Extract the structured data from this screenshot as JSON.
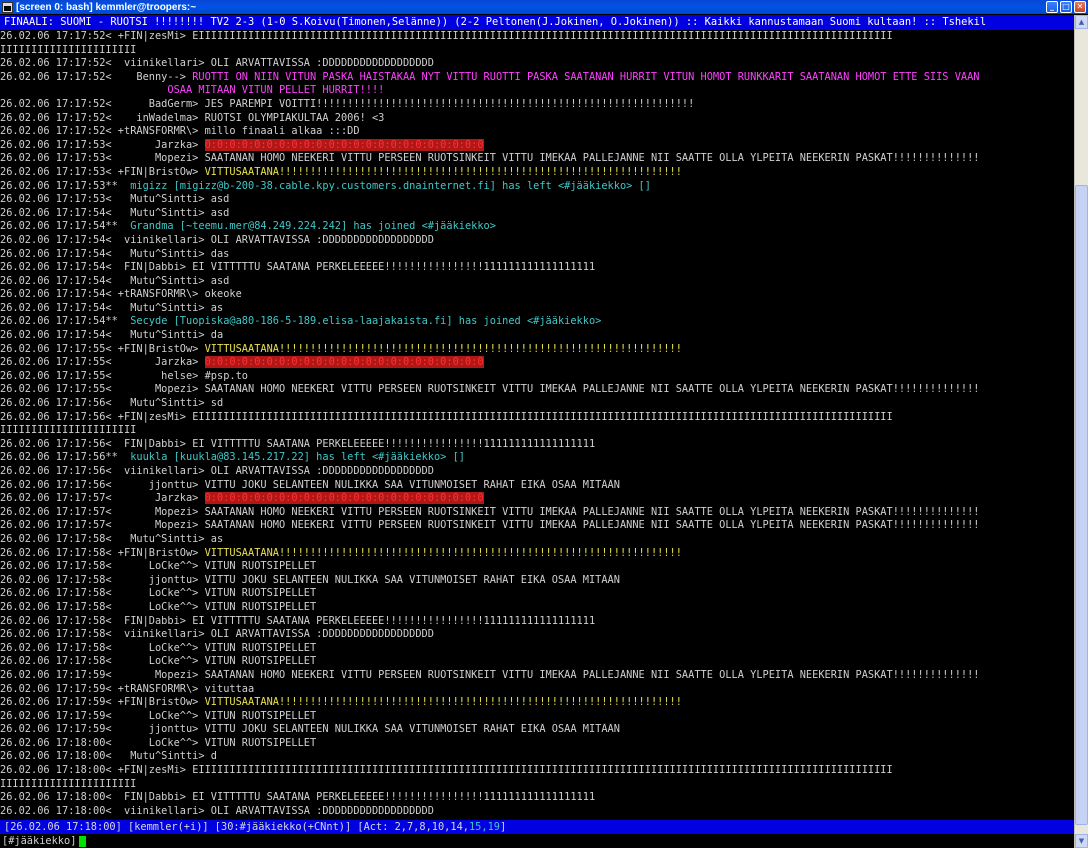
{
  "window": {
    "title": "[screen 0: bash] kemmler@troopers:~",
    "icon": "putty-terminal-icon"
  },
  "topic": "FINAALI: SUOMI - RUOTSI !!!!!!!! TV2 2-3 (1-0 S.Koivu(Timonen,Selänne)) (2-2 Peltonen(J.Jokinen, O.Jokinen)) :: Kaikki kannustamaan Suomi kultaan! :: Tshekil",
  "colors": {
    "magenta": "#ff40ff",
    "yellow": "#e8e04c",
    "cyan": "#3fc8c8",
    "red": "#b01818",
    "blue_bar": "#0000e0",
    "cursor": "#00e000"
  },
  "lines": [
    {
      "ts": "26.02.06 17:17:52",
      "nick": "< +FIN|zesMi> ",
      "msg": "EIIIIIIIIIIIIIIIIIIIIIIIIIIIIIIIIIIIIIIIIIIIIIIIIIIIIIIIIIIIIIIIIIIIIIIIIIIIIIIIIIIIIIIIIIIIIIIIIIIIIIIIIIIIIIIII",
      "style": ""
    },
    {
      "ts": "",
      "nick": "",
      "msg": "IIIIIIIIIIIIIIIIIIIIII",
      "style": ""
    },
    {
      "ts": "26.02.06 17:17:52",
      "nick": "<  viinikellari> ",
      "msg": "OLI ARVATTAVISSA :DDDDDDDDDDDDDDDDDD",
      "style": ""
    },
    {
      "ts": "26.02.06 17:17:52",
      "nick": "<    Benny--> ",
      "msg": "RUOTTI ON NIIN VITUN PASKA HAISTAKAA NYT VITTU RUOTTI PASKA SAATANAN HURRIT VITUN HOMOT RUNKKARIT SAATANAN HOMOT ETTE SIIS VAAN",
      "style": "magenta"
    },
    {
      "ts": "",
      "nick": "                           ",
      "msg": "OSAA MITAAN VITUN PELLET HURRIT!!!!",
      "style": "magenta"
    },
    {
      "ts": "26.02.06 17:17:52",
      "nick": "<      BadGerm> ",
      "msg": "JES PAREMPI VOITTI!!!!!!!!!!!!!!!!!!!!!!!!!!!!!!!!!!!!!!!!!!!!!!!!!!!!!!!!!!!!!",
      "style": ""
    },
    {
      "ts": "26.02.06 17:17:52",
      "nick": "<    inWadelma> ",
      "msg": "RUOTSI OLYMPIAKULTAA 2006! <3",
      "style": ""
    },
    {
      "ts": "26.02.06 17:17:52",
      "nick": "< +tRANSFORMR\\> ",
      "msg": "millo finaali alkaa :::DD",
      "style": ""
    },
    {
      "ts": "26.02.06 17:17:53",
      "nick": "<       Jarzka> ",
      "msg": "0:0:0:0:0:0:0:0:0:0:0:0:0:0:0:0:0:0:0:0:0:0:0",
      "style": "redbg"
    },
    {
      "ts": "26.02.06 17:17:53",
      "nick": "<       Mopezi> ",
      "msg": "SAATANAN HOMO NEEKERI VITTU PERSEEN RUOTSINKEIT VITTU IMEKÄÄ PALLEJANNE NII SAATTE OLLA YLPEITÄ NEEKERIN PASKAT!!!!!!!!!!!!!!",
      "style": ""
    },
    {
      "ts": "26.02.06 17:17:53",
      "nick": "< +FIN|BristOw> ",
      "msg": "VITTUSAATANA!!!!!!!!!!!!!!!!!!!!!!!!!!!!!!!!!!!!!!!!!!!!!!!!!!!!!!!!!!!!!!!!!",
      "style": "yellow"
    },
    {
      "ts": "26.02.06 17:17:53",
      "nick": "**  ",
      "msg": "migizz [migizz@b-200-38.cable.kpy.customers.dnainternet.fi] has left <#jääkiekko> []",
      "style": "cyan"
    },
    {
      "ts": "26.02.06 17:17:53",
      "nick": "<   Mutu^Sintti> ",
      "msg": "asd",
      "style": ""
    },
    {
      "ts": "26.02.06 17:17:54",
      "nick": "<   Mutu^Sintti> ",
      "msg": "asd",
      "style": ""
    },
    {
      "ts": "26.02.06 17:17:54",
      "nick": "**  ",
      "msg": "Grandma [~teemu.mer@84.249.224.242] has joined <#jääkiekko>",
      "style": "cyan"
    },
    {
      "ts": "26.02.06 17:17:54",
      "nick": "<  viinikellari> ",
      "msg": "OLI ARVATTAVISSA :DDDDDDDDDDDDDDDDDD",
      "style": ""
    },
    {
      "ts": "26.02.06 17:17:54",
      "nick": "<   Mutu^Sintti> ",
      "msg": "das",
      "style": ""
    },
    {
      "ts": "26.02.06 17:17:54",
      "nick": "<  FIN|Dabbi> ",
      "msg": "EI VITTTTTU SAATANA PERKELEEEEE!!!!!!!!!!!!!!!!111111111111111111",
      "style": ""
    },
    {
      "ts": "26.02.06 17:17:54",
      "nick": "<   Mutu^Sintti> ",
      "msg": "asd",
      "style": ""
    },
    {
      "ts": "26.02.06 17:17:54",
      "nick": "< +tRANSFORMR\\> ",
      "msg": "okeoke",
      "style": ""
    },
    {
      "ts": "26.02.06 17:17:54",
      "nick": "<   Mutu^Sintti> ",
      "msg": "as",
      "style": ""
    },
    {
      "ts": "26.02.06 17:17:54",
      "nick": "**  ",
      "msg": "Secyde [Tuopiska@a80-186-5-189.elisa-laajakaista.fi] has joined <#jääkiekko>",
      "style": "cyan"
    },
    {
      "ts": "26.02.06 17:17:54",
      "nick": "<   Mutu^Sintti> ",
      "msg": "da",
      "style": ""
    },
    {
      "ts": "26.02.06 17:17:55",
      "nick": "< +FIN|BristOw> ",
      "msg": "VITTUSAATANA!!!!!!!!!!!!!!!!!!!!!!!!!!!!!!!!!!!!!!!!!!!!!!!!!!!!!!!!!!!!!!!!!",
      "style": "yellow"
    },
    {
      "ts": "26.02.06 17:17:55",
      "nick": "<       Jarzka> ",
      "msg": "0:0:0:0:0:0:0:0:0:0:0:0:0:0:0:0:0:0:0:0:0:0:0",
      "style": "redbg"
    },
    {
      "ts": "26.02.06 17:17:55",
      "nick": "<        helse> ",
      "msg": "#psp.to",
      "style": ""
    },
    {
      "ts": "26.02.06 17:17:55",
      "nick": "<       Mopezi> ",
      "msg": "SAATANAN HOMO NEEKERI VITTU PERSEEN RUOTSINKEIT VITTU IMEKÄÄ PALLEJANNE NII SAATTE OLLA YLPEITÄ NEEKERIN PASKAT!!!!!!!!!!!!!!",
      "style": ""
    },
    {
      "ts": "26.02.06 17:17:56",
      "nick": "<   Mutu^Sintti> ",
      "msg": "sd",
      "style": ""
    },
    {
      "ts": "26.02.06 17:17:56",
      "nick": "< +FIN|zesMi> ",
      "msg": "EIIIIIIIIIIIIIIIIIIIIIIIIIIIIIIIIIIIIIIIIIIIIIIIIIIIIIIIIIIIIIIIIIIIIIIIIIIIIIIIIIIIIIIIIIIIIIIIIIIIIIIIIIIIIIIII",
      "style": ""
    },
    {
      "ts": "",
      "nick": "",
      "msg": "IIIIIIIIIIIIIIIIIIIIII",
      "style": ""
    },
    {
      "ts": "26.02.06 17:17:56",
      "nick": "<  FIN|Dabbi> ",
      "msg": "EI VITTTTTU SAATANA PERKELEEEEE!!!!!!!!!!!!!!!!111111111111111111",
      "style": ""
    },
    {
      "ts": "26.02.06 17:17:56",
      "nick": "**  ",
      "msg": "kuukla [kuukla@83.145.217.22] has left <#jääkiekko> []",
      "style": "cyan"
    },
    {
      "ts": "26.02.06 17:17:56",
      "nick": "<  viinikellari> ",
      "msg": "OLI ARVATTAVISSA :DDDDDDDDDDDDDDDDDD",
      "style": ""
    },
    {
      "ts": "26.02.06 17:17:56",
      "nick": "<      jjonttu> ",
      "msg": "VITTU JOKU SELÄNTEEN NULIKKA SAA VITUNMOISET RAHAT EIKÄ OSAA MITÄÄN",
      "style": ""
    },
    {
      "ts": "26.02.06 17:17:57",
      "nick": "<       Jarzka> ",
      "msg": "0:0:0:0:0:0:0:0:0:0:0:0:0:0:0:0:0:0:0:0:0:0:0",
      "style": "redbg"
    },
    {
      "ts": "26.02.06 17:17:57",
      "nick": "<       Mopezi> ",
      "msg": "SAATANAN HOMO NEEKERI VITTU PERSEEN RUOTSINKEIT VITTU IMEKÄÄ PALLEJANNE NII SAATTE OLLA YLPEITÄ NEEKERIN PASKAT!!!!!!!!!!!!!!",
      "style": ""
    },
    {
      "ts": "26.02.06 17:17:57",
      "nick": "<       Mopezi> ",
      "msg": "SAATANAN HOMO NEEKERI VITTU PERSEEN RUOTSINKEIT VITTU IMEKÄÄ PALLEJANNE NII SAATTE OLLA YLPEITÄ NEEKERIN PASKAT!!!!!!!!!!!!!!",
      "style": ""
    },
    {
      "ts": "26.02.06 17:17:58",
      "nick": "<   Mutu^Sintti> ",
      "msg": "as",
      "style": ""
    },
    {
      "ts": "26.02.06 17:17:58",
      "nick": "< +FIN|BristOw> ",
      "msg": "VITTUSAATANA!!!!!!!!!!!!!!!!!!!!!!!!!!!!!!!!!!!!!!!!!!!!!!!!!!!!!!!!!!!!!!!!!",
      "style": "yellow"
    },
    {
      "ts": "26.02.06 17:17:58",
      "nick": "<      LoCke^^> ",
      "msg": "VITUN RUOTSIPELLET",
      "style": ""
    },
    {
      "ts": "26.02.06 17:17:58",
      "nick": "<      jjonttu> ",
      "msg": "VITTU JOKU SELÄNTEEN NULIKKA SAA VITUNMOISET RAHAT EIKÄ OSAA MITÄÄN",
      "style": ""
    },
    {
      "ts": "26.02.06 17:17:58",
      "nick": "<      LoCke^^> ",
      "msg": "VITUN RUOTSIPELLET",
      "style": ""
    },
    {
      "ts": "26.02.06 17:17:58",
      "nick": "<      LoCke^^> ",
      "msg": "VITUN RUOTSIPELLET",
      "style": ""
    },
    {
      "ts": "26.02.06 17:17:58",
      "nick": "<  FIN|Dabbi> ",
      "msg": "EI VITTTTTU SAATANA PERKELEEEEE!!!!!!!!!!!!!!!!111111111111111111",
      "style": ""
    },
    {
      "ts": "26.02.06 17:17:58",
      "nick": "<  viinikellari> ",
      "msg": "OLI ARVATTAVISSA :DDDDDDDDDDDDDDDDDD",
      "style": ""
    },
    {
      "ts": "26.02.06 17:17:58",
      "nick": "<      LoCke^^> ",
      "msg": "VITUN RUOTSIPELLET",
      "style": ""
    },
    {
      "ts": "26.02.06 17:17:58",
      "nick": "<      LoCke^^> ",
      "msg": "VITUN RUOTSIPELLET",
      "style": ""
    },
    {
      "ts": "26.02.06 17:17:59",
      "nick": "<       Mopezi> ",
      "msg": "SAATANAN HOMO NEEKERI VITTU PERSEEN RUOTSINKEIT VITTU IMEKÄÄ PALLEJANNE NII SAATTE OLLA YLPEITÄ NEEKERIN PASKAT!!!!!!!!!!!!!!",
      "style": ""
    },
    {
      "ts": "26.02.06 17:17:59",
      "nick": "< +tRANSFORMR\\> ",
      "msg": "vituttaa",
      "style": ""
    },
    {
      "ts": "26.02.06 17:17:59",
      "nick": "< +FIN|BristOw> ",
      "msg": "VITTUSAATANA!!!!!!!!!!!!!!!!!!!!!!!!!!!!!!!!!!!!!!!!!!!!!!!!!!!!!!!!!!!!!!!!!",
      "style": "yellow"
    },
    {
      "ts": "26.02.06 17:17:59",
      "nick": "<      LoCke^^> ",
      "msg": "VITUN RUOTSIPELLET",
      "style": ""
    },
    {
      "ts": "26.02.06 17:17:59",
      "nick": "<      jjonttu> ",
      "msg": "VITTU JOKU SELÄNTEEN NULIKKA SAA VITUNMOISET RAHAT EIKÄ OSAA MITÄÄN",
      "style": ""
    },
    {
      "ts": "26.02.06 17:18:00",
      "nick": "<      LoCke^^> ",
      "msg": "VITUN RUOTSIPELLET",
      "style": ""
    },
    {
      "ts": "26.02.06 17:18:00",
      "nick": "<   Mutu^Sintti> ",
      "msg": "d",
      "style": ""
    },
    {
      "ts": "26.02.06 17:18:00",
      "nick": "< +FIN|zesMi> ",
      "msg": "EIIIIIIIIIIIIIIIIIIIIIIIIIIIIIIIIIIIIIIIIIIIIIIIIIIIIIIIIIIIIIIIIIIIIIIIIIIIIIIIIIIIIIIIIIIIIIIIIIIIIIIIIIIIIIIII",
      "style": ""
    },
    {
      "ts": "",
      "nick": "",
      "msg": "IIIIIIIIIIIIIIIIIIIIII",
      "style": ""
    },
    {
      "ts": "26.02.06 17:18:00",
      "nick": "<  FIN|Dabbi> ",
      "msg": "EI VITTTTTU SAATANA PERKELEEEEE!!!!!!!!!!!!!!!!111111111111111111",
      "style": ""
    },
    {
      "ts": "26.02.06 17:18:00",
      "nick": "<  viinikellari> ",
      "msg": "OLI ARVATTAVISSA :DDDDDDDDDDDDDDDDDD",
      "style": ""
    }
  ],
  "statusbar": {
    "time": "[26.02.06 17:18:00]",
    "user": "[kemmler(+i)]",
    "channel": "[30:#jääkiekko(+CNnt)]",
    "act_prefix": "[Act: 2,7,8,10,14,",
    "act_highlight": "15,19",
    "act_suffix": "]"
  },
  "input": {
    "prompt": "[#jääkiekko]",
    "value": ""
  }
}
